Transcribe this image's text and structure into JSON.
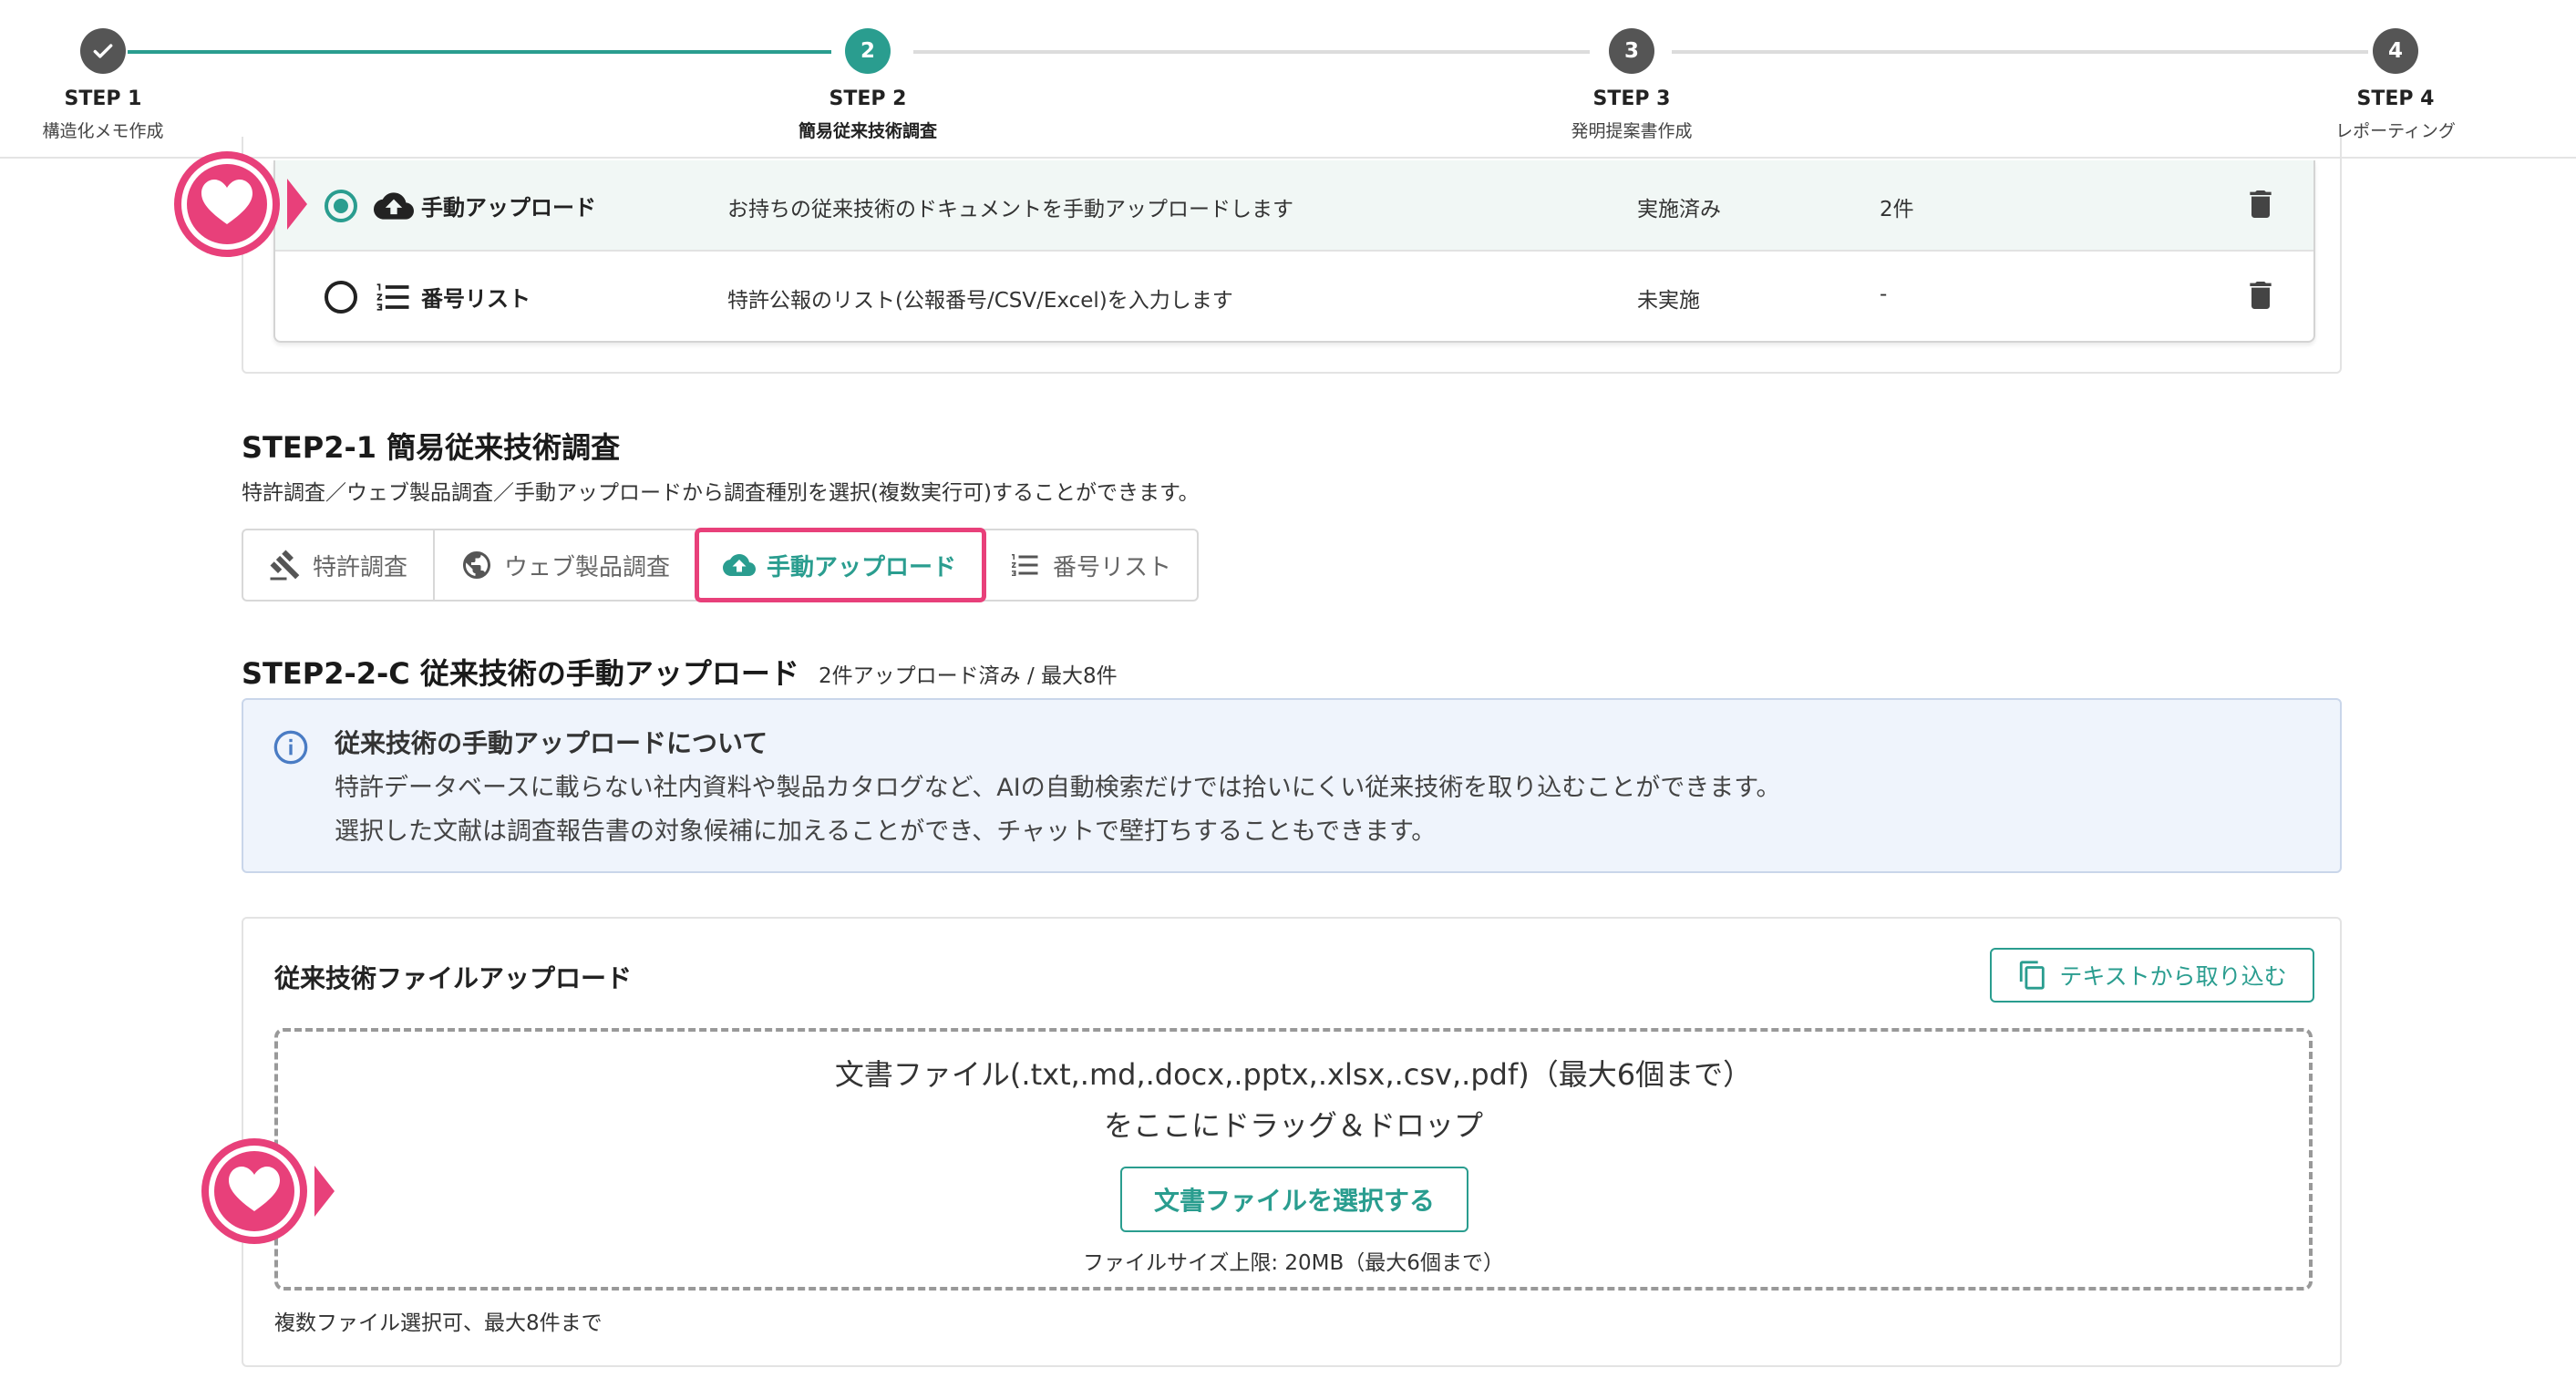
{
  "stepper": {
    "steps": [
      {
        "name": "STEP 1",
        "sub": "構造化メモ作成",
        "marker": "check"
      },
      {
        "name": "STEP 2",
        "sub": "簡易従来技術調査",
        "marker": "2"
      },
      {
        "name": "STEP 3",
        "sub": "発明提案書作成",
        "marker": "3"
      },
      {
        "name": "STEP 4",
        "sub": "レポーティング",
        "marker": "4"
      }
    ],
    "current": 2
  },
  "methods_table": {
    "rows": [
      {
        "name": "手動アップロード",
        "desc": "お持ちの従来技術のドキュメントを手動アップロードします",
        "status": "実施済み",
        "count": "2件",
        "selected": true,
        "icon": "cloud-upload-icon"
      },
      {
        "name": "番号リスト",
        "desc": "特許公報のリスト(公報番号/CSV/Excel)を入力します",
        "status": "未実施",
        "count": "-",
        "selected": false,
        "icon": "numbered-list-icon"
      }
    ]
  },
  "section21": {
    "title": "STEP2-1 簡易従来技術調査",
    "desc": "特許調査／ウェブ製品調査／手動アップロードから調査種別を選択(複数実行可)することができます。",
    "tabs": [
      {
        "label": "特許調査",
        "icon": "gavel-icon"
      },
      {
        "label": "ウェブ製品調査",
        "icon": "globe-icon"
      },
      {
        "label": "手動アップロード",
        "icon": "cloud-upload-icon",
        "active": true
      },
      {
        "label": "番号リスト",
        "icon": "numbered-list-icon"
      }
    ]
  },
  "section22c": {
    "title": "STEP2-2-C 従来技術の手動アップロード",
    "badge": "2件アップロード済み / 最大8件"
  },
  "info": {
    "title": "従来技術の手動アップロードについて",
    "line1": "特許データベースに載らない社内資料や製品カタログなど、AIの自動検索だけでは拾いにくい従来技術を取り込むことができます。",
    "line2": "選択した文献は調査報告書の対象候補に加えることができ、チャットで壁打ちすることもできます。"
  },
  "upload": {
    "title": "従来技術ファイルアップロード",
    "text_import_label": "テキストから取り込む",
    "drop_line1": "文書ファイル(.txt,.md,.docx,.pptx,.xlsx,.csv,.pdf)（最大6個まで）",
    "drop_line2": "をここにドラッグ＆ドロップ",
    "select_button": "文書ファイルを選択する",
    "size_limit": "ファイルサイズ上限: 20MB（最大6個まで）",
    "note": "複数ファイル選択可、最大8件まで"
  },
  "colors": {
    "accent": "#2a9d8f",
    "highlight": "#e8407a",
    "info_bg": "#eff4fc"
  }
}
